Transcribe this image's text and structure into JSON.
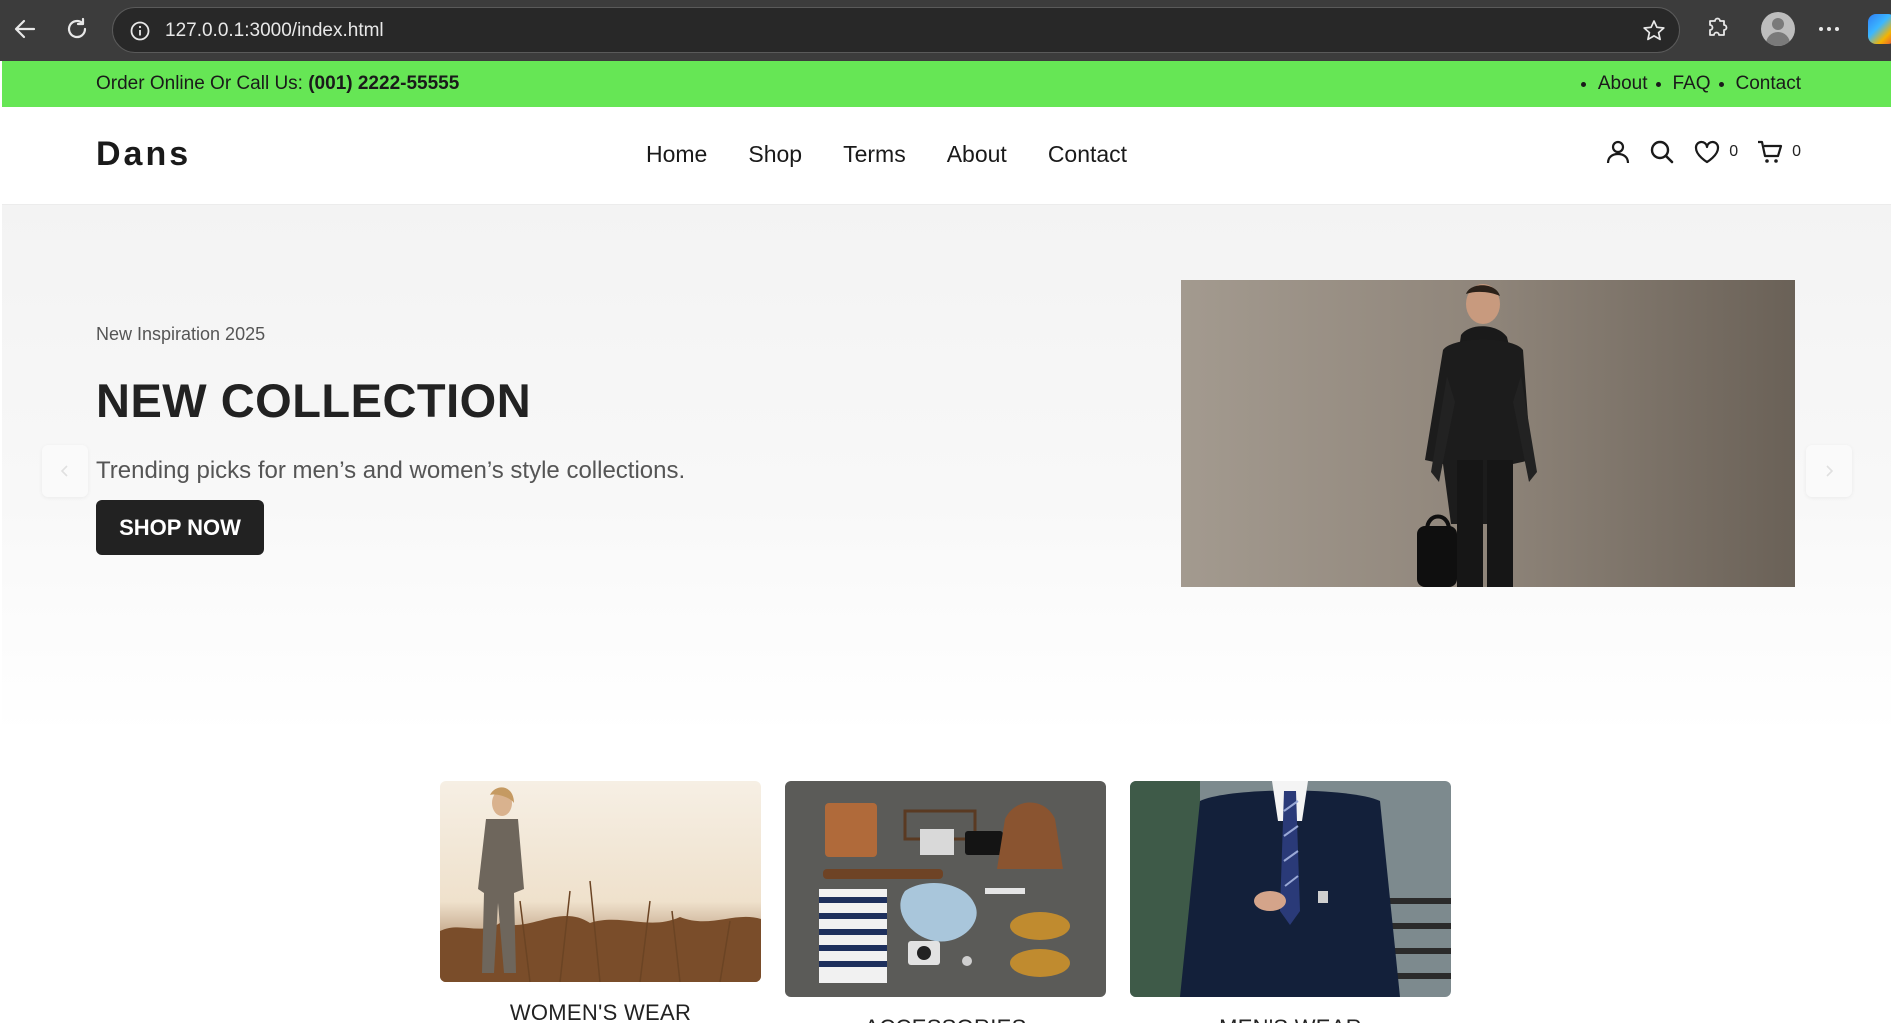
{
  "browser": {
    "url": "127.0.0.1:3000/index.html"
  },
  "topbar": {
    "order_prefix": "Order Online Or Call Us:",
    "phone": "(001) 2222-55555",
    "links": [
      "About",
      "FAQ",
      "Contact"
    ]
  },
  "header": {
    "logo": "Dans",
    "nav": [
      "Home",
      "Shop",
      "Terms",
      "About",
      "Contact"
    ],
    "wishlist_count": "0",
    "cart_count": "0"
  },
  "hero": {
    "subtitle": "New Inspiration 2025",
    "title": "NEW COLLECTION",
    "description": "Trending picks for men’s and women’s style collections.",
    "button": "SHOP NOW",
    "prev_icon": "chevron-left-icon",
    "next_icon": "chevron-right-icon"
  },
  "categories": [
    {
      "label": "WOMEN'S WEAR"
    },
    {
      "label": "ACCESSORIES"
    },
    {
      "label": "MEN'S WEAR"
    }
  ],
  "colors": {
    "topbar_bg": "#66e655",
    "button_bg": "#222222",
    "chrome_bg": "#3c3c3c"
  }
}
